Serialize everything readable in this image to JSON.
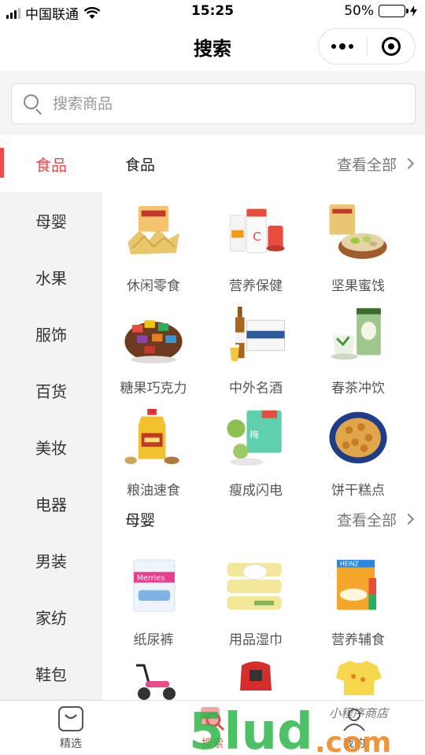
{
  "status_bar": {
    "carrier": "中国联通",
    "time": "15:25",
    "battery_percent": "50%",
    "battery_level": 0.5
  },
  "nav": {
    "title": "搜索"
  },
  "search": {
    "placeholder": "搜索商品"
  },
  "sidebar": {
    "items": [
      {
        "label": "食品",
        "active": true
      },
      {
        "label": "母婴"
      },
      {
        "label": "水果"
      },
      {
        "label": "服饰"
      },
      {
        "label": "百货"
      },
      {
        "label": "美妆"
      },
      {
        "label": "电器"
      },
      {
        "label": "男装"
      },
      {
        "label": "家纺"
      },
      {
        "label": "鞋包"
      }
    ]
  },
  "sections": [
    {
      "title": "食品",
      "more": "查看全部",
      "items": [
        {
          "label": "休闲零食",
          "icon": "chips-icon"
        },
        {
          "label": "营养保健",
          "icon": "supplement-icon"
        },
        {
          "label": "坚果蜜饯",
          "icon": "pistachio-icon"
        },
        {
          "label": "糖果巧克力",
          "icon": "candy-icon"
        },
        {
          "label": "中外名酒",
          "icon": "beer-icon"
        },
        {
          "label": "春茶冲饮",
          "icon": "tea-icon"
        },
        {
          "label": "粮油速食",
          "icon": "oil-icon"
        },
        {
          "label": "瘦成闪电",
          "icon": "enzyme-plum-icon"
        },
        {
          "label": "饼干糕点",
          "icon": "cookie-icon"
        }
      ]
    },
    {
      "title": "母婴",
      "more": "查看全部",
      "items": [
        {
          "label": "纸尿裤",
          "icon": "diaper-icon"
        },
        {
          "label": "用品湿巾",
          "icon": "wipes-icon"
        },
        {
          "label": "营养辅食",
          "icon": "baby-food-icon"
        },
        {
          "label": "",
          "icon": "scooter-icon"
        },
        {
          "label": "",
          "icon": "car-seat-icon"
        },
        {
          "label": "",
          "icon": "baby-clothes-icon"
        }
      ]
    }
  ],
  "tabbar": {
    "tabs": [
      {
        "label": "精选",
        "icon": "bag-icon"
      },
      {
        "label": "搜索",
        "icon": "search-tab-icon",
        "active": true
      },
      {
        "label": "我的",
        "icon": "user-icon"
      }
    ]
  },
  "watermark": {
    "text_main": "5lud.com",
    "text_script": "小程序商店"
  },
  "colors": {
    "accent": "#f04a4e",
    "sidebar_bg": "#f3f3f3",
    "search_bg": "#f5f5f5"
  }
}
